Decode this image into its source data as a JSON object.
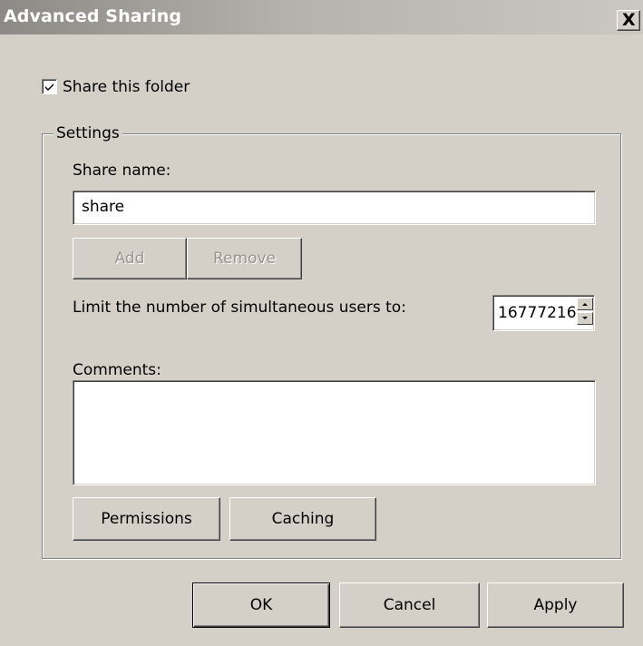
{
  "window": {
    "title": "Advanced Sharing",
    "close_glyph": "X"
  },
  "share_folder": {
    "checked": true,
    "label": "Share this folder"
  },
  "settings": {
    "group_label": "Settings",
    "share_name_label": "Share name:",
    "share_name_value": "share",
    "add_label": "Add",
    "remove_label": "Remove",
    "limit_label": "Limit the number of simultaneous users to:",
    "limit_value": "16777216",
    "comments_label": "Comments:",
    "comments_value": "",
    "permissions_label": "Permissions",
    "caching_label": "Caching"
  },
  "footer": {
    "ok_label": "OK",
    "cancel_label": "Cancel",
    "apply_label": "Apply"
  },
  "icons": {
    "checkbox": "checkmark-icon",
    "spin_up": "up-arrow-icon",
    "spin_down": "down-arrow-icon",
    "close": "close-icon"
  }
}
